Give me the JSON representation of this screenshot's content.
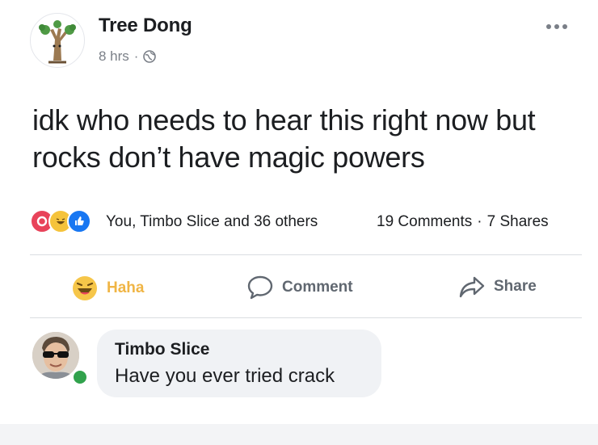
{
  "post": {
    "author": "Tree Dong",
    "time": "8 hrs",
    "separator": "·",
    "text": "idk who needs to hear this right now but rocks don’t have magic powers",
    "reactions_text": "You, Timbo Slice and 36 others",
    "comments_count": "19 Comments",
    "shares_count": "7 Shares"
  },
  "actions": {
    "haha_label": "Haha",
    "comment_label": "Comment",
    "share_label": "Share"
  },
  "comment": {
    "author": "Timbo Slice",
    "text": "Have you ever tried crack"
  },
  "icons": {
    "post_avatar": "tree-avatar-icon",
    "privacy": "globe-icon",
    "more": "more-options-icon",
    "reactions": [
      "love-reaction-icon",
      "haha-reaction-icon",
      "like-reaction-icon"
    ],
    "haha": "haha-icon",
    "comment": "comment-icon",
    "share": "share-icon"
  },
  "colors": {
    "haha_active": "#f0b545",
    "love": "#e8435a",
    "like": "#1877f2",
    "online": "#31a24c"
  }
}
